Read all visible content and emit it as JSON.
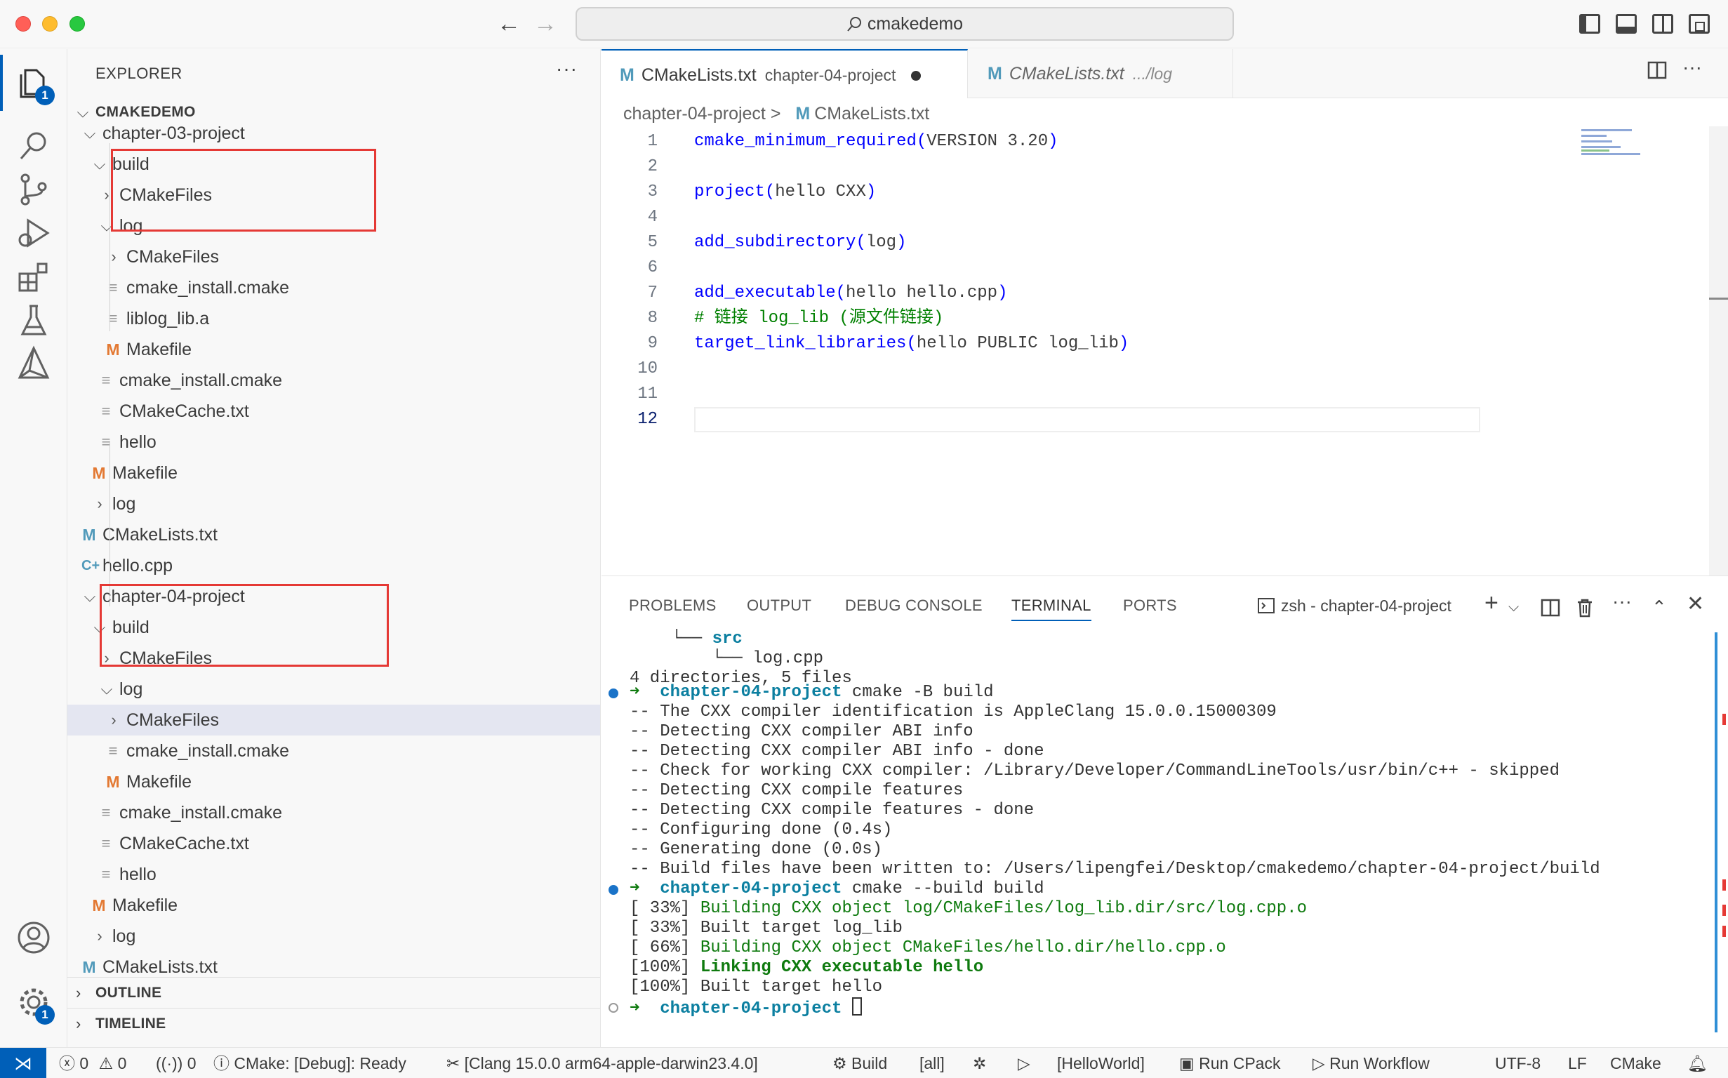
{
  "window": {
    "command_center": "cmakedemo"
  },
  "activity": {
    "explorer_badge": "1",
    "settings_badge": "1"
  },
  "sidebar": {
    "title": "EXPLORER",
    "more": "···",
    "root": "CMAKEDEMO",
    "items": [
      {
        "label": "chapter-03-project",
        "kind": "folder",
        "open": true
      },
      {
        "label": "build",
        "kind": "folder",
        "open": true
      },
      {
        "label": "CMakeFiles",
        "kind": "folder",
        "open": false
      },
      {
        "label": "log",
        "kind": "folder",
        "open": true
      },
      {
        "label": "CMakeFiles",
        "kind": "folder",
        "open": false
      },
      {
        "label": "cmake_install.cmake",
        "kind": "file"
      },
      {
        "label": "liblog_lib.a",
        "kind": "file"
      },
      {
        "label": "Makefile",
        "kind": "makefile"
      },
      {
        "label": "cmake_install.cmake",
        "kind": "file"
      },
      {
        "label": "CMakeCache.txt",
        "kind": "file"
      },
      {
        "label": "hello",
        "kind": "file"
      },
      {
        "label": "Makefile",
        "kind": "makefile"
      },
      {
        "label": "log",
        "kind": "folder",
        "open": false
      },
      {
        "label": "CMakeLists.txt",
        "kind": "cmake"
      },
      {
        "label": "hello.cpp",
        "kind": "cpp"
      },
      {
        "label": "chapter-04-project",
        "kind": "folder",
        "open": true
      },
      {
        "label": "build",
        "kind": "folder",
        "open": true
      },
      {
        "label": "CMakeFiles",
        "kind": "folder",
        "open": false
      },
      {
        "label": "log",
        "kind": "folder",
        "open": true
      },
      {
        "label": "CMakeFiles",
        "kind": "folder",
        "open": false
      },
      {
        "label": "cmake_install.cmake",
        "kind": "file"
      },
      {
        "label": "Makefile",
        "kind": "makefile"
      },
      {
        "label": "cmake_install.cmake",
        "kind": "file"
      },
      {
        "label": "CMakeCache.txt",
        "kind": "file"
      },
      {
        "label": "hello",
        "kind": "file"
      },
      {
        "label": "Makefile",
        "kind": "makefile"
      },
      {
        "label": "log",
        "kind": "folder",
        "open": false
      },
      {
        "label": "CMakeLists.txt",
        "kind": "cmake"
      }
    ],
    "outline": "OUTLINE",
    "timeline": "TIMELINE"
  },
  "tabs": [
    {
      "file": "CMakeLists.txt",
      "desc": "chapter-04-project",
      "icon": "M"
    },
    {
      "file": "CMakeLists.txt",
      "desc": ".../log",
      "icon": "M"
    }
  ],
  "breadcrumb": {
    "folder": "chapter-04-project",
    "sep": ">",
    "icon": "M",
    "file": "CMakeLists.txt"
  },
  "editor": {
    "lines": [
      {
        "n": "1",
        "fn": "cmake_minimum_required(",
        "rest": "VERSION 3.20",
        "close": ")"
      },
      {
        "n": "2",
        "fn": "",
        "rest": "",
        "close": ""
      },
      {
        "n": "3",
        "fn": "project(",
        "rest": "hello CXX",
        "close": ")"
      },
      {
        "n": "4",
        "fn": "",
        "rest": "",
        "close": ""
      },
      {
        "n": "5",
        "fn": "add_subdirectory(",
        "rest": "log",
        "close": ")"
      },
      {
        "n": "6",
        "fn": "",
        "rest": "",
        "close": ""
      },
      {
        "n": "7",
        "fn": "add_executable(",
        "rest": "hello hello.cpp",
        "close": ")"
      },
      {
        "n": "8",
        "comment": "# 链接 log_lib (源文件链接)"
      },
      {
        "n": "9",
        "fn": "target_link_libraries(",
        "rest": "hello PUBLIC log_lib",
        "close": ")"
      },
      {
        "n": "10",
        "fn": "",
        "rest": "",
        "close": ""
      },
      {
        "n": "11",
        "fn": "",
        "rest": "",
        "close": ""
      },
      {
        "n": "12",
        "fn": "",
        "rest": "",
        "close": ""
      }
    ]
  },
  "panel": {
    "tabs": [
      "PROBLEMS",
      "OUTPUT",
      "DEBUG CONSOLE",
      "TERMINAL",
      "PORTS"
    ],
    "active_tab": "TERMINAL",
    "terminal_name": "zsh - chapter-04-project",
    "terminal": {
      "tree1": "└── src",
      "tree2": "    └── log.cpp",
      "summary": "4 directories, 5 files",
      "prompt1_dir": "chapter-04-project",
      "prompt1_cmd": "cmake -B build",
      "out1": [
        "-- The CXX compiler identification is AppleClang 15.0.0.15000309",
        "-- Detecting CXX compiler ABI info",
        "-- Detecting CXX compiler ABI info - done",
        "-- Check for working CXX compiler: /Library/Developer/CommandLineTools/usr/bin/c++ - skipped",
        "-- Detecting CXX compile features",
        "-- Detecting CXX compile features - done",
        "-- Configuring done (0.4s)",
        "-- Generating done (0.0s)",
        "-- Build files have been written to: /Users/lipengfei/Desktop/cmakedemo/chapter-04-project/build"
      ],
      "prompt2_dir": "chapter-04-project",
      "prompt2_cmd": "cmake --build build",
      "b1_pct": "[ 33%]",
      "b1_txt": "Building CXX object log/CMakeFiles/log_lib.dir/src/log.cpp.o",
      "b2_pct": "[ 33%]",
      "b2_txt": "Built target log_lib",
      "b3_pct": "[ 66%]",
      "b3_txt": "Building CXX object CMakeFiles/hello.dir/hello.cpp.o",
      "b4_pct": "[100%]",
      "b4_txt": "Linking CXX executable hello",
      "b5_pct": "[100%]",
      "b5_txt": "Built target hello",
      "prompt3_dir": "chapter-04-project",
      "arrow": "➜"
    }
  },
  "status": {
    "errors": "0",
    "warnings": "0",
    "ports": "0",
    "cmake_status": "CMake: [Debug]: Ready",
    "kit": "[Clang 15.0.0 arm64-apple-darwin23.4.0]",
    "build": "Build",
    "target": "[all]",
    "launch_target": "[HelloWorld]",
    "cpack": "Run CPack",
    "workflow": "Run Workflow",
    "encoding": "UTF-8",
    "eol": "LF",
    "language": "CMake"
  }
}
